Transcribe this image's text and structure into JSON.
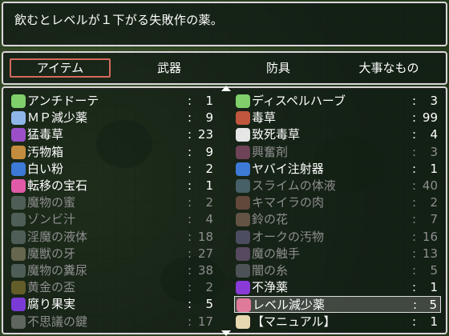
{
  "help": {
    "text": "飲むとレベルが１下がる失敗作の薬。"
  },
  "categories": [
    {
      "label": "アイテム",
      "selected": true
    },
    {
      "label": "武器",
      "selected": false
    },
    {
      "label": "防具",
      "selected": false
    },
    {
      "label": "大事なもの",
      "selected": false
    }
  ],
  "items": [
    {
      "name": "アンチドーテ",
      "qty": "1",
      "icon": "green-bottle-icon",
      "color": "#7fcf6b",
      "enabled": true
    },
    {
      "name": "ディスペルハーブ",
      "qty": "3",
      "icon": "green-bottle-icon",
      "color": "#7fcf6b",
      "enabled": true
    },
    {
      "name": "ＭＰ減少薬",
      "qty": "9",
      "icon": "blue-flask-icon",
      "color": "#8fb6e8",
      "enabled": true
    },
    {
      "name": "毒草",
      "qty": "99",
      "icon": "red-herb-icon",
      "color": "#c0563d",
      "enabled": true
    },
    {
      "name": "猛毒草",
      "qty": "23",
      "icon": "purple-herb-icon",
      "color": "#9a4fc9",
      "enabled": true
    },
    {
      "name": "致死毒草",
      "qty": "4",
      "icon": "skull-icon",
      "color": "#e6e6e6",
      "enabled": true
    },
    {
      "name": "汚物箱",
      "qty": "9",
      "icon": "crate-icon",
      "color": "#c48c3e",
      "enabled": true
    },
    {
      "name": "興奮剤",
      "qty": "3",
      "icon": "heart-potion-icon",
      "color": "#b65b8c",
      "enabled": false
    },
    {
      "name": "白い粉",
      "qty": "2",
      "icon": "powder-icon",
      "color": "#3d79d6",
      "enabled": true
    },
    {
      "name": "ヤバイ注射器",
      "qty": "1",
      "icon": "syringe-icon",
      "color": "#3d79d6",
      "enabled": true
    },
    {
      "name": "転移の宝石",
      "qty": "1",
      "icon": "pink-gem-icon",
      "color": "#e05aa8",
      "enabled": true
    },
    {
      "name": "スライムの体液",
      "qty": "40",
      "icon": "jar-icon",
      "color": "#6f8fa8",
      "enabled": false
    },
    {
      "name": "魔物の蜜",
      "qty": "2",
      "icon": "jar-icon",
      "color": "#7a8a8a",
      "enabled": false
    },
    {
      "name": "キマイラの肉",
      "qty": "2",
      "icon": "meat-icon",
      "color": "#a0665a",
      "enabled": false
    },
    {
      "name": "ゾンビ汁",
      "qty": "4",
      "icon": "jar-icon",
      "color": "#7a8a8a",
      "enabled": false
    },
    {
      "name": "鈴の花",
      "qty": "7",
      "icon": "flower-icon",
      "color": "#a07a6a",
      "enabled": false
    },
    {
      "name": "淫魔の液体",
      "qty": "18",
      "icon": "jar-icon",
      "color": "#7a8a8a",
      "enabled": false
    },
    {
      "name": "オークの汚物",
      "qty": "16",
      "icon": "jar-icon",
      "color": "#7a6fa0",
      "enabled": false
    },
    {
      "name": "魔獣の牙",
      "qty": "27",
      "icon": "fang-icon",
      "color": "#a89a7a",
      "enabled": false
    },
    {
      "name": "魔の触手",
      "qty": "13",
      "icon": "tentacle-icon",
      "color": "#8a6a9a",
      "enabled": false
    },
    {
      "name": "魔物の糞尿",
      "qty": "38",
      "icon": "jar-icon",
      "color": "#7a8a8a",
      "enabled": false
    },
    {
      "name": "闇の糸",
      "qty": "5",
      "icon": "thread-icon",
      "color": "#7a7a8a",
      "enabled": false
    },
    {
      "name": "黄金の盃",
      "qty": "2",
      "icon": "chalice-icon",
      "color": "#a08a3a",
      "enabled": false
    },
    {
      "name": "不浄薬",
      "qty": "1",
      "icon": "purple-orb-icon",
      "color": "#8a3ad6",
      "enabled": true
    },
    {
      "name": "腐り果実",
      "qty": "5",
      "icon": "rotten-fruit-icon",
      "color": "#7a3ad6",
      "enabled": true
    },
    {
      "name": "レベル減少薬",
      "qty": "5",
      "icon": "pink-flask-icon",
      "color": "#e07a9a",
      "enabled": true,
      "selected": true
    },
    {
      "name": "不思議の鍵",
      "qty": "17",
      "icon": "key-icon",
      "color": "#9a9a9a",
      "enabled": false
    },
    {
      "name": "【マニュアル】",
      "qty": "1",
      "icon": "book-icon",
      "color": "#e8d8b0",
      "enabled": true
    }
  ]
}
